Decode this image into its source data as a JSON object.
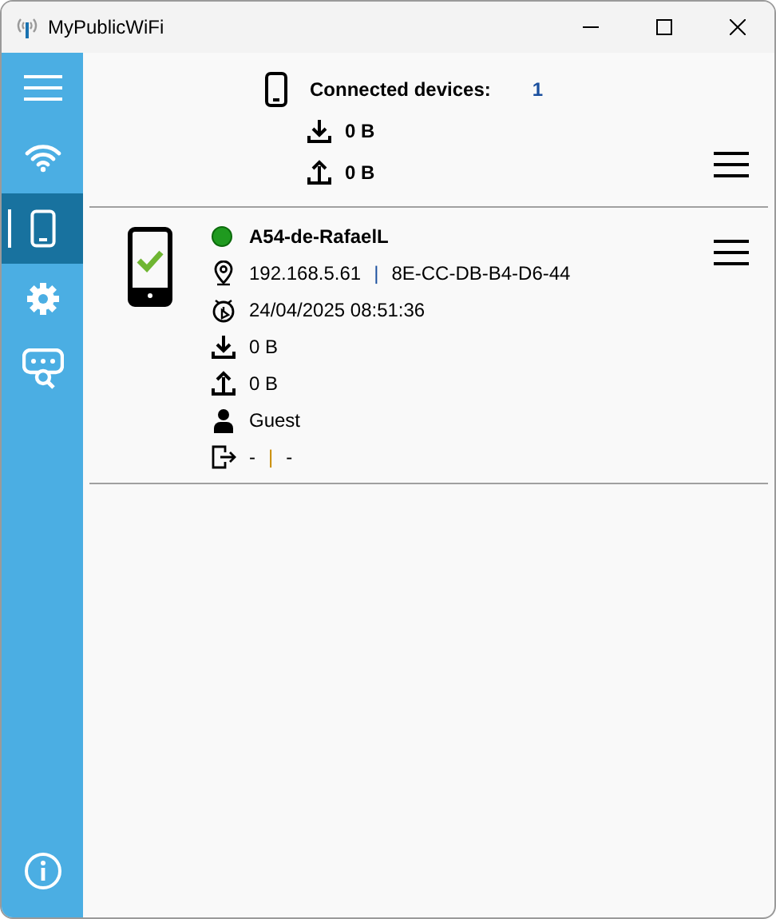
{
  "window": {
    "title": "MyPublicWiFi"
  },
  "sidebar": {
    "items": [
      {
        "kind": "menu",
        "selected": false
      },
      {
        "kind": "wifi",
        "selected": false
      },
      {
        "kind": "devices",
        "selected": true
      },
      {
        "kind": "settings",
        "selected": false
      },
      {
        "kind": "web",
        "selected": false
      }
    ],
    "footer": {
      "kind": "info"
    }
  },
  "summary": {
    "label": "Connected devices:",
    "count": "1",
    "download": "0 B",
    "upload": "0 B"
  },
  "devices": [
    {
      "name": "A54-de-RafaelL",
      "online": true,
      "ip": "192.168.5.61",
      "ip_separator": "|",
      "mac": "8E-CC-DB-B4-D6-44",
      "connected_at": "24/04/2025 08:51:36",
      "download": "0 B",
      "upload": "0 B",
      "user": "Guest",
      "session_start": "-",
      "session_separator": "|",
      "session_end": "-"
    }
  ]
}
